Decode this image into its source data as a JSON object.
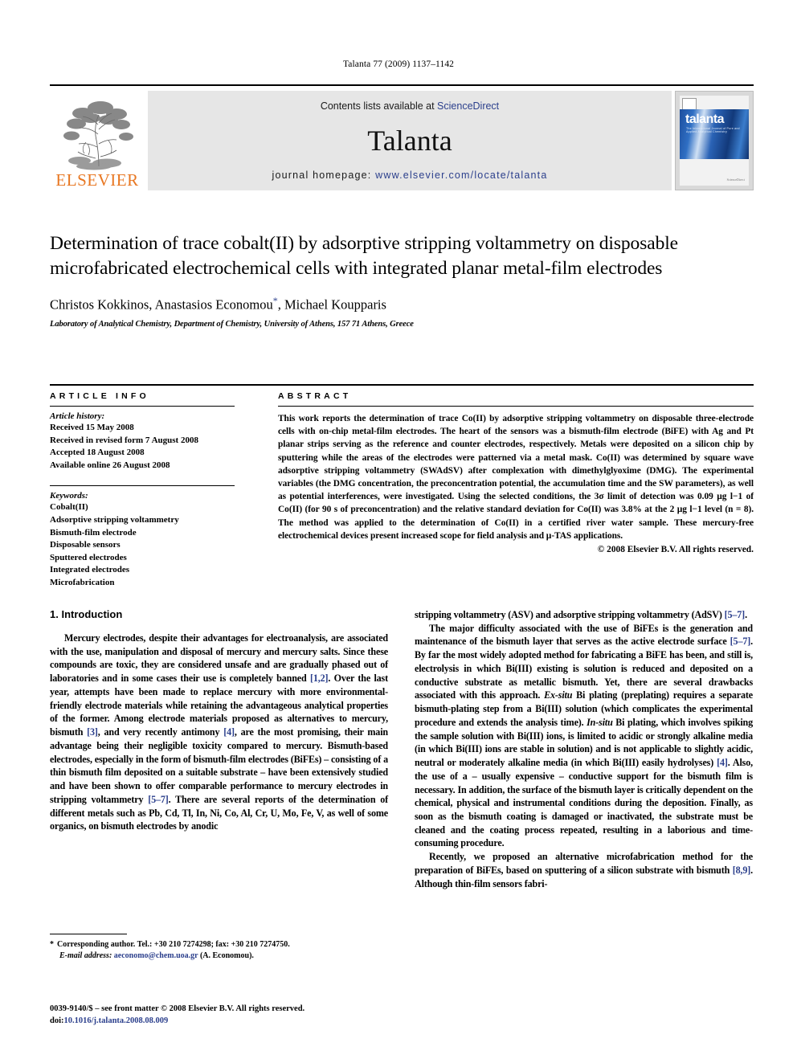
{
  "running_head": "Talanta 77 (2009) 1137–1142",
  "masthead": {
    "publisher_name": "ELSEVIER",
    "contents_prefix": "Contents lists available at ",
    "contents_link": "ScienceDirect",
    "journal_name": "Talanta",
    "homepage_prefix": "journal homepage: ",
    "homepage_url": "www.elsevier.com/locate/talanta",
    "cover_title": "talanta",
    "cover_subtitle": "The International Journal of Pure and Applied Analytical Chemistry",
    "link_color": "#2b3f8c",
    "elsevier_orange": "#E87722",
    "band_bg": "#e6e6e6"
  },
  "article": {
    "title": "Determination of trace cobalt(II) by adsorptive stripping voltammetry on disposable microfabricated electrochemical cells with integrated planar metal-film electrodes",
    "authors": "Christos Kokkinos, Anastasios Economou",
    "authors_tail": ", Michael Koupparis",
    "corresponding_marker": "*",
    "affiliation": "Laboratory of Analytical Chemistry, Department of Chemistry, University of Athens, 157 71 Athens, Greece"
  },
  "article_info": {
    "heading": "ARTICLE INFO",
    "history_label": "Article history:",
    "history": [
      "Received 15 May 2008",
      "Received in revised form 7 August 2008",
      "Accepted 18 August 2008",
      "Available online 26 August 2008"
    ],
    "keywords_label": "Keywords:",
    "keywords": [
      "Cobalt(II)",
      "Adsorptive stripping voltammetry",
      "Bismuth-film electrode",
      "Disposable sensors",
      "Sputtered electrodes",
      "Integrated electrodes",
      "Microfabrication"
    ]
  },
  "abstract": {
    "heading": "ABSTRACT",
    "text": "This work reports the determination of trace Co(II) by adsorptive stripping voltammetry on disposable three-electrode cells with on-chip metal-film electrodes. The heart of the sensors was a bismuth-film electrode (BiFE) with Ag and Pt planar strips serving as the reference and counter electrodes, respectively. Metals were deposited on a silicon chip by sputtering while the areas of the electrodes were patterned via a metal mask. Co(II) was determined by square wave adsorptive stripping voltammetry (SWAdSV) after complexation with dimethylglyoxime (DMG). The experimental variables (the DMG concentration, the preconcentration potential, the accumulation time and the SW parameters), as well as potential interferences, were investigated. Using the selected conditions, the 3σ limit of detection was 0.09 µg l−1 of Co(II) (for 90 s of preconcentration) and the relative standard deviation for Co(II) was 3.8% at the 2 µg l−1 level (n = 8). The method was applied to the determination of Co(II) in a certified river water sample. These mercury-free electrochemical devices present increased scope for field analysis and µ-TAS applications.",
    "copyright": "© 2008 Elsevier B.V. All rights reserved."
  },
  "body": {
    "section_heading": "1. Introduction",
    "left_paragraphs": [
      "Mercury electrodes, despite their advantages for electroanalysis, are associated with the use, manipulation and disposal of mercury and mercury salts. Since these compounds are toxic, they are considered unsafe and are gradually phased out of laboratories and in some cases their use is completely banned [1,2]. Over the last year, attempts have been made to replace mercury with more environmental-friendly electrode materials while retaining the advantageous analytical properties of the former. Among electrode materials proposed as alternatives to mercury, bismuth [3], and very recently antimony [4], are the most promising, their main advantage being their negligible toxicity compared to mercury. Bismuth-based electrodes, especially in the form of bismuth-film electrodes (BiFEs) – consisting of a thin bismuth film deposited on a suitable substrate – have been extensively studied and have been shown to offer comparable performance to mercury electrodes in stripping voltammetry [5–7]. There are several reports of the determination of different metals such as Pb, Cd, Tl, In, Ni, Co, Al, Cr, U, Mo, Fe, V, as well of some organics, on bismuth electrodes by anodic"
    ],
    "right_paragraphs": [
      "stripping voltammetry (ASV) and adsorptive stripping voltammetry (AdSV) [5–7].",
      "The major difficulty associated with the use of BiFEs is the generation and maintenance of the bismuth layer that serves as the active electrode surface [5–7]. By far the most widely adopted method for fabricating a BiFE has been, and still is, electrolysis in which Bi(III) existing is solution is reduced and deposited on a conductive substrate as metallic bismuth. Yet, there are several drawbacks associated with this approach. Ex-situ Bi plating (preplating) requires a separate bismuth-plating step from a Bi(III) solution (which complicates the experimental procedure and extends the analysis time). In-situ Bi plating, which involves spiking the sample solution with Bi(III) ions, is limited to acidic or strongly alkaline media (in which Bi(III) ions are stable in solution) and is not applicable to slightly acidic, neutral or moderately alkaline media (in which Bi(III) easily hydrolyses) [4]. Also, the use of a – usually expensive – conductive support for the bismuth film is necessary. In addition, the surface of the bismuth layer is critically dependent on the chemical, physical and instrumental conditions during the deposition. Finally, as soon as the bismuth coating is damaged or inactivated, the substrate must be cleaned and the coating process repeated, resulting in a laborious and time-consuming procedure.",
      "Recently, we proposed an alternative microfabrication method for the preparation of BiFEs, based on sputtering of a silicon substrate with bismuth [8,9]. Although thin-film sensors fabri-"
    ]
  },
  "footnote": {
    "marker": "*",
    "text": "Corresponding author. Tel.: +30 210 7274298; fax: +30 210 7274750.",
    "email_label": "E-mail address:",
    "email": "aeconomo@chem.uoa.gr",
    "email_suffix": " (A. Economou)."
  },
  "footer": {
    "line1": "0039-9140/$ – see front matter © 2008 Elsevier B.V. All rights reserved.",
    "doi_label": "doi:",
    "doi": "10.1016/j.talanta.2008.08.009"
  }
}
